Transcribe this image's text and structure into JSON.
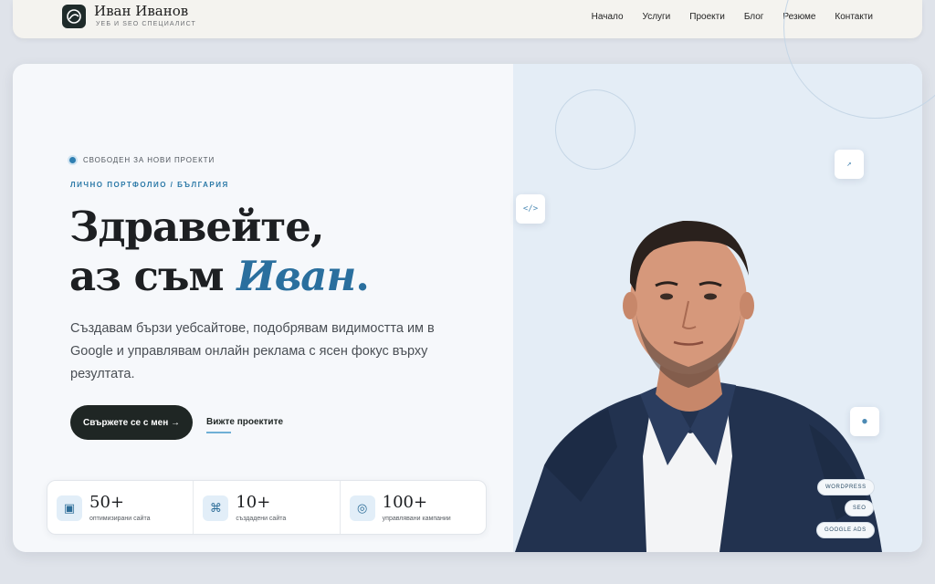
{
  "header": {
    "brand_name": "Иван Иванов",
    "brand_sub": "УЕБ И SEO СПЕЦИАЛИСТ",
    "nav": [
      "Начало",
      "Услуги",
      "Проекти",
      "Блог",
      "Резюме",
      "Контакти"
    ]
  },
  "hero": {
    "status": "СВОБОДЕН ЗА НОВИ ПРОЕКТИ",
    "eyebrow": "ЛИЧНО ПОРТФОЛИО / БЪЛГАРИЯ",
    "headline_line1": "Здравейте,",
    "headline_line2_prefix": "аз съм ",
    "headline_name": "Иван",
    "headline_dot": ".",
    "lead": "Създавам бързи уебсайтове, подобрявам видимостта им в Google и управлявам онлайн реклама с ясен фокус върху резултата.",
    "cta_primary": "Свържете се с мен →",
    "cta_secondary": "Вижте проектите"
  },
  "chips": {
    "code": "</>",
    "pen": "↗",
    "dot": "●"
  },
  "tags": [
    "WORDPRESS",
    "SEO",
    "GOOGLE ADS"
  ],
  "stats": [
    {
      "icon": "▣",
      "value": "50+",
      "label": "оптимизирани сайта"
    },
    {
      "icon": "⌘",
      "value": "10+",
      "label": "създадени сайта"
    },
    {
      "icon": "◎",
      "value": "100+",
      "label": "управлявани кампании"
    }
  ],
  "colors": {
    "accent": "#2a6f9e",
    "dark": "#1f2624"
  }
}
